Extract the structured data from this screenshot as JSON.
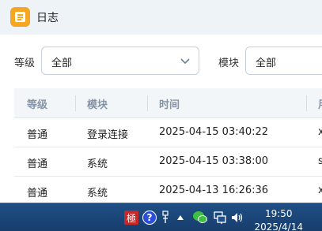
{
  "window": {
    "title": "日志",
    "icon": "log-app-icon"
  },
  "filters": {
    "level_label": "等级",
    "level_value": "全部",
    "module_label": "模块",
    "module_value": "全部"
  },
  "table": {
    "columns": [
      "等级",
      "模块",
      "时间",
      "用"
    ],
    "rows": [
      {
        "level": "普通",
        "module": "登录连接",
        "time": "2025-04-15 03:40:22",
        "extra": "x"
      },
      {
        "level": "普通",
        "module": "系统",
        "time": "2025-04-15 03:38:00",
        "extra": "s"
      },
      {
        "level": "普通",
        "module": "系统",
        "time": "2025-04-13 16:26:36",
        "extra": "x"
      }
    ]
  },
  "taskbar": {
    "clock_time": "19:50",
    "clock_date": "2025/4/14",
    "icons": [
      "ime-icon",
      "help-icon",
      "usb-icon",
      "tray-expand-icon",
      "wechat-icon",
      "network-icon",
      "volume-icon"
    ],
    "help_glyph": "?",
    "ime_glyph": "極"
  }
}
